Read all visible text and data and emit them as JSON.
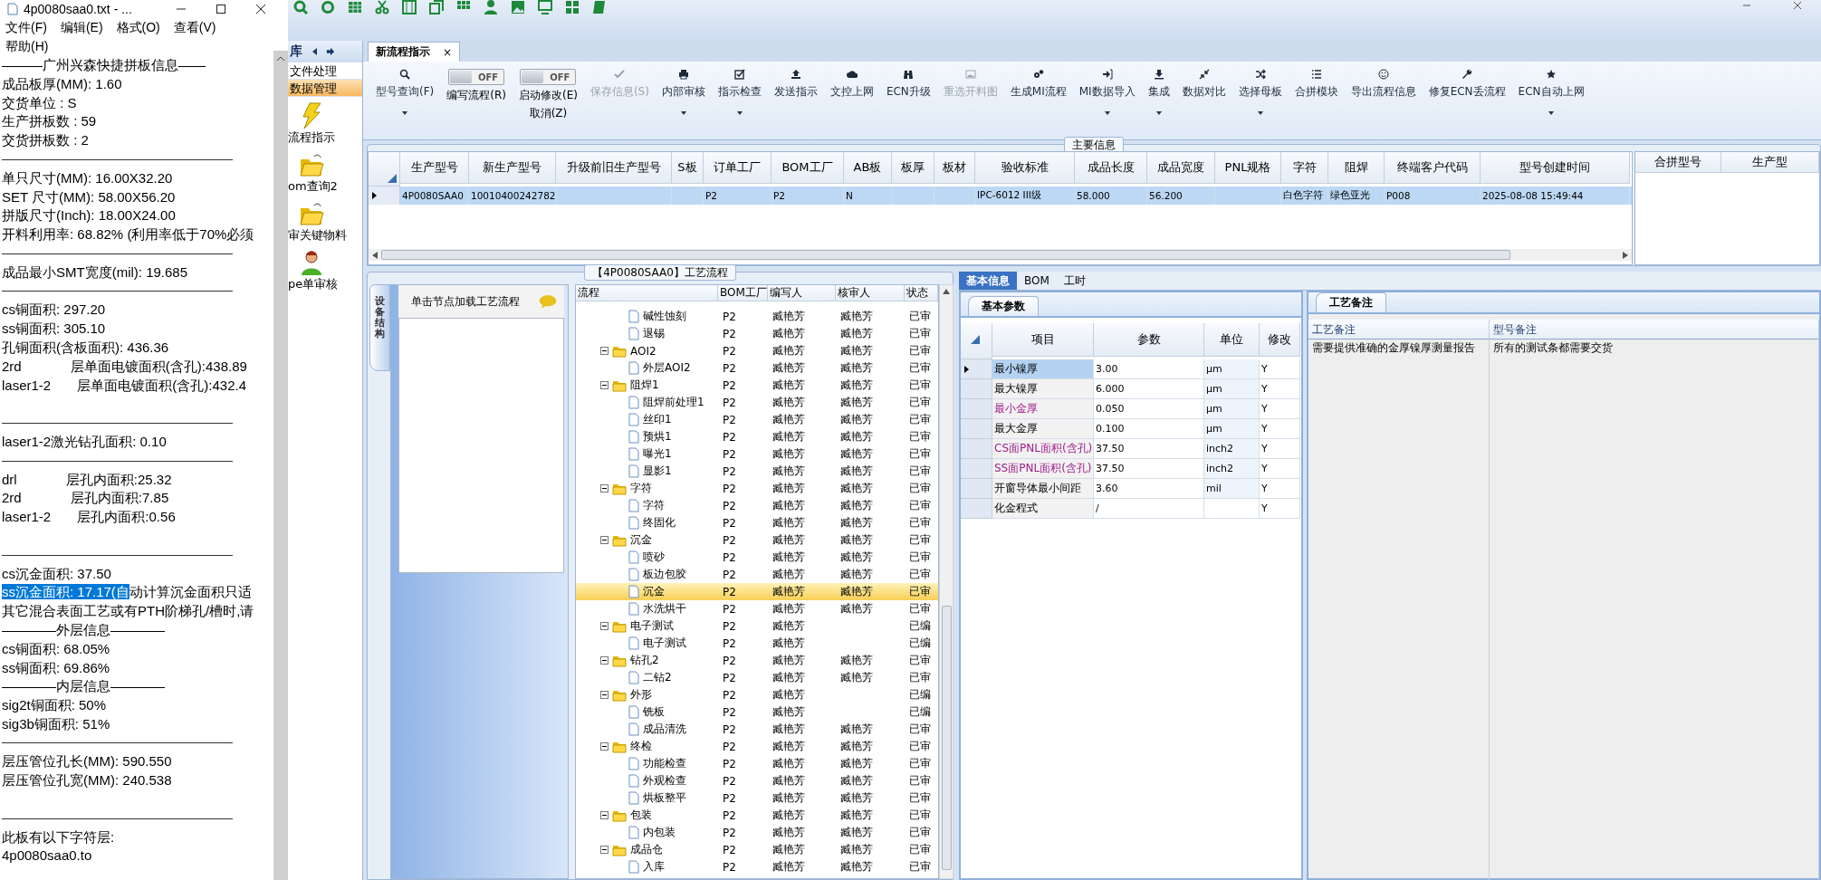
{
  "notepad": {
    "title": "4p0080saa0.txt - ...",
    "menu": [
      "文件(F)",
      "编辑(E)",
      "格式(O)",
      "查看(V)",
      "帮助(H)"
    ],
    "lines": [
      {
        "kind": "text",
        "text": "———广州兴森快捷拼板信息——"
      },
      {
        "kind": "text",
        "text": "成品板厚(MM): 1.60"
      },
      {
        "kind": "text",
        "text": "交货单位 : S"
      },
      {
        "kind": "text",
        "text": "生产拼板数 : 59"
      },
      {
        "kind": "text",
        "text": "交货拼板数 : 2"
      },
      {
        "kind": "rule"
      },
      {
        "kind": "text",
        "text": "单只尺寸(MM): 16.00X32.20"
      },
      {
        "kind": "text",
        "text": "SET 尺寸(MM): 58.00X56.20"
      },
      {
        "kind": "text",
        "text": "拼版尺寸(Inch): 18.00X24.00"
      },
      {
        "kind": "text",
        "text": "开料利用率: 68.82% (利用率低于70%必须"
      },
      {
        "kind": "rule"
      },
      {
        "kind": "text",
        "text": "成品最小SMT宽度(mil): 19.685"
      },
      {
        "kind": "rule"
      },
      {
        "kind": "text",
        "text": "cs铜面积: 297.20"
      },
      {
        "kind": "text",
        "text": "ss铜面积: 305.10"
      },
      {
        "kind": "text",
        "text": "孔铜面积(含板面积): 436.36"
      },
      {
        "kind": "text",
        "text": "2rd             层单面电镀面积(含孔):438.89"
      },
      {
        "kind": "text",
        "text": "laser1-2       层单面电镀面积(含孔):432.4"
      },
      {
        "kind": "blank"
      },
      {
        "kind": "rule"
      },
      {
        "kind": "text",
        "text": "laser1-2激光钻孔面积: 0.10"
      },
      {
        "kind": "rule"
      },
      {
        "kind": "text",
        "text": "drl             层孔内面积:25.32"
      },
      {
        "kind": "text",
        "text": "2rd             层孔内面积:7.85"
      },
      {
        "kind": "text",
        "text": "laser1-2       层孔内面积:0.56"
      },
      {
        "kind": "blank"
      },
      {
        "kind": "rule"
      },
      {
        "kind": "text",
        "text": "cs沉金面积: 37.50"
      },
      {
        "kind": "text",
        "selected_text": "ss沉金面积: 17.17(自",
        "text": "动计算沉金面积只适"
      },
      {
        "kind": "text",
        "text": "其它混合表面工艺或有PTH阶梯孔/槽时,请"
      },
      {
        "kind": "text",
        "text": "————外层信息————"
      },
      {
        "kind": "text",
        "text": "cs铜面积: 68.05%"
      },
      {
        "kind": "text",
        "text": "ss铜面积: 69.86%"
      },
      {
        "kind": "text",
        "text": "————内层信息————"
      },
      {
        "kind": "text",
        "text": "sig2t铜面积: 50%"
      },
      {
        "kind": "text",
        "text": "sig3b铜面积: 51%"
      },
      {
        "kind": "rule"
      },
      {
        "kind": "text",
        "text": "层压管位孔长(MM): 590.550"
      },
      {
        "kind": "text",
        "text": "层压管位孔宽(MM): 240.538"
      },
      {
        "kind": "blank"
      },
      {
        "kind": "rule"
      },
      {
        "kind": "text",
        "text": "此板有以下字符层:"
      },
      {
        "kind": "text",
        "text": "4p0080saa0.to"
      }
    ]
  },
  "sidebar": {
    "title": "库",
    "items": [
      {
        "label": "文件处理",
        "selected": false
      },
      {
        "label": "数据管理",
        "selected": true
      }
    ],
    "tools": [
      {
        "label": "流程指示"
      },
      {
        "label": "om查询2"
      },
      {
        "label": "审关键物料"
      },
      {
        "label": "pe单审核"
      }
    ]
  },
  "document_tab": {
    "label": "新流程指示",
    "close": "×"
  },
  "ribbon": {
    "buttons": [
      {
        "kind": "button",
        "label": "型号查询(F)",
        "dropdown": true,
        "disabled": false
      },
      {
        "kind": "toggle",
        "switch_text": "OFF",
        "on": false,
        "label": "编写流程(R)"
      },
      {
        "kind": "toggle",
        "switch_text": "OFF",
        "on": false,
        "label": "启动修改(E)",
        "sub_label": "取消(Z)"
      },
      {
        "kind": "button",
        "label": "保存信息(S)",
        "dropdown": false,
        "disabled": true
      },
      {
        "kind": "button",
        "label": "内部审核",
        "dropdown": true,
        "disabled": false
      },
      {
        "kind": "button",
        "label": "指示检查",
        "dropdown": true,
        "disabled": false
      },
      {
        "kind": "button",
        "label": "发送指示",
        "dropdown": false,
        "disabled": false
      },
      {
        "kind": "button",
        "label": "文控上网",
        "dropdown": false,
        "disabled": false
      },
      {
        "kind": "button",
        "label": "ECN升级",
        "dropdown": false,
        "disabled": false
      },
      {
        "kind": "button",
        "label": "重选开料图",
        "dropdown": false,
        "disabled": true
      },
      {
        "kind": "button",
        "label": "生成MI流程",
        "dropdown": false,
        "disabled": false
      },
      {
        "kind": "button",
        "label": "MI数据导入",
        "dropdown": true,
        "disabled": false
      },
      {
        "kind": "button",
        "label": "集成",
        "dropdown": true,
        "disabled": false
      },
      {
        "kind": "button",
        "label": "数据对比",
        "dropdown": false,
        "disabled": false
      },
      {
        "kind": "button",
        "label": "选择母板",
        "dropdown": true,
        "disabled": false
      },
      {
        "kind": "button",
        "label": "合拼模块",
        "dropdown": false,
        "disabled": false
      },
      {
        "kind": "button",
        "label": "导出流程信息",
        "dropdown": false,
        "disabled": false
      },
      {
        "kind": "button",
        "label": "修复ECN丢流程",
        "dropdown": false,
        "disabled": false
      },
      {
        "kind": "button",
        "label": "ECN自动上网",
        "dropdown": true,
        "disabled": false
      }
    ]
  },
  "main_info": {
    "title": "主要信息",
    "columns": [
      "生产型号",
      "新生产型号",
      "升级前旧生产型号",
      "S板",
      "订单工厂",
      "BOM工厂",
      "AB板",
      "板厚",
      "板材",
      "验收标准",
      "成品长度",
      "成品宽度",
      "PNL规格",
      "字符",
      "阻焊",
      "终端客户代码",
      "型号创建时间"
    ],
    "rows": [
      {
        "selected": true,
        "cells": [
          "4P0080SAA0",
          "10010400242782",
          "",
          "",
          "P2",
          "P2",
          "N",
          "",
          "",
          "IPC-6012 III级",
          "58.000",
          "56.200",
          "",
          "白色字符",
          "绿色亚光",
          "P008",
          "2025-08-08 15:49:44"
        ]
      }
    ],
    "merge_columns": [
      "合拼型号",
      "生产型"
    ]
  },
  "process_flow": {
    "title": "【4P0080SAA0】工艺流程",
    "side_tab": "设备结构",
    "hint": "单击节点加载工艺流程",
    "columns": [
      "流程",
      "BOM工厂",
      "编写人",
      "核审人",
      "状态"
    ],
    "nodes": [
      {
        "kind": "group_scrolled",
        "children": [
          {
            "label": "碱性蚀刻",
            "bom_factory": "P2",
            "author": "臧艳芳",
            "reviewer": "臧艳芳",
            "status": "已审",
            "selected": false
          },
          {
            "label": "退锡",
            "bom_factory": "P2",
            "author": "臧艳芳",
            "reviewer": "臧艳芳",
            "status": "已审",
            "selected": false
          }
        ]
      },
      {
        "kind": "group",
        "label": "AOI2",
        "bom_factory": "P2",
        "author": "臧艳芳",
        "reviewer": "臧艳芳",
        "status": "已审",
        "selected": false,
        "expanded": true,
        "children": [
          {
            "label": "外层AOI2",
            "bom_factory": "P2",
            "author": "臧艳芳",
            "reviewer": "臧艳芳",
            "status": "已审",
            "selected": false
          }
        ]
      },
      {
        "kind": "group",
        "label": "阻焊1",
        "bom_factory": "P2",
        "author": "臧艳芳",
        "reviewer": "臧艳芳",
        "status": "已审",
        "selected": false,
        "expanded": true,
        "children": [
          {
            "label": "阻焊前处理1",
            "bom_factory": "P2",
            "author": "臧艳芳",
            "reviewer": "臧艳芳",
            "status": "已审",
            "selected": false
          },
          {
            "label": "丝印1",
            "bom_factory": "P2",
            "author": "臧艳芳",
            "reviewer": "臧艳芳",
            "status": "已审",
            "selected": false
          },
          {
            "label": "预烘1",
            "bom_factory": "P2",
            "author": "臧艳芳",
            "reviewer": "臧艳芳",
            "status": "已审",
            "selected": false
          },
          {
            "label": "曝光1",
            "bom_factory": "P2",
            "author": "臧艳芳",
            "reviewer": "臧艳芳",
            "status": "已审",
            "selected": false
          },
          {
            "label": "显影1",
            "bom_factory": "P2",
            "author": "臧艳芳",
            "reviewer": "臧艳芳",
            "status": "已审",
            "selected": false
          }
        ]
      },
      {
        "kind": "group",
        "label": "字符",
        "bom_factory": "P2",
        "author": "臧艳芳",
        "reviewer": "臧艳芳",
        "status": "已审",
        "selected": false,
        "expanded": true,
        "children": [
          {
            "label": "字符",
            "bom_factory": "P2",
            "author": "臧艳芳",
            "reviewer": "臧艳芳",
            "status": "已审",
            "selected": false
          },
          {
            "label": "终固化",
            "bom_factory": "P2",
            "author": "臧艳芳",
            "reviewer": "臧艳芳",
            "status": "已审",
            "selected": false
          }
        ]
      },
      {
        "kind": "group",
        "label": "沉金",
        "bom_factory": "P2",
        "author": "臧艳芳",
        "reviewer": "臧艳芳",
        "status": "已审",
        "selected": false,
        "expanded": true,
        "children": [
          {
            "label": "喷砂",
            "bom_factory": "P2",
            "author": "臧艳芳",
            "reviewer": "臧艳芳",
            "status": "已审",
            "selected": false
          },
          {
            "label": "板边包胶",
            "bom_factory": "P2",
            "author": "臧艳芳",
            "reviewer": "臧艳芳",
            "status": "已审",
            "selected": false
          },
          {
            "label": "沉金",
            "bom_factory": "P2",
            "author": "臧艳芳",
            "reviewer": "臧艳芳",
            "status": "已审",
            "selected": true
          },
          {
            "label": "水洗烘干",
            "bom_factory": "P2",
            "author": "臧艳芳",
            "reviewer": "臧艳芳",
            "status": "已审",
            "selected": false
          }
        ]
      },
      {
        "kind": "group",
        "label": "电子测试",
        "bom_factory": "P2",
        "author": "臧艳芳",
        "status": "已编",
        "selected": false,
        "expanded": true,
        "children": [
          {
            "label": "电子测试",
            "bom_factory": "P2",
            "author": "臧艳芳",
            "status": "已编",
            "selected": false
          }
        ]
      },
      {
        "kind": "group",
        "label": "钻孔2",
        "bom_factory": "P2",
        "author": "臧艳芳",
        "reviewer": "臧艳芳",
        "status": "已审",
        "selected": false,
        "expanded": true,
        "children": [
          {
            "label": "二钻2",
            "bom_factory": "P2",
            "author": "臧艳芳",
            "reviewer": "臧艳芳",
            "status": "已审",
            "selected": false
          }
        ]
      },
      {
        "kind": "group",
        "label": "外形",
        "bom_factory": "P2",
        "author": "臧艳芳",
        "status": "已编",
        "selected": false,
        "expanded": true,
        "children": [
          {
            "label": "铣板",
            "bom_factory": "P2",
            "author": "臧艳芳",
            "status": "已编",
            "selected": false
          },
          {
            "label": "成品清洗",
            "bom_factory": "P2",
            "author": "臧艳芳",
            "reviewer": "臧艳芳",
            "status": "已审",
            "selected": false
          }
        ]
      },
      {
        "kind": "group",
        "label": "终检",
        "bom_factory": "P2",
        "author": "臧艳芳",
        "reviewer": "臧艳芳",
        "status": "已审",
        "selected": false,
        "expanded": true,
        "children": [
          {
            "label": "功能检查",
            "bom_factory": "P2",
            "author": "臧艳芳",
            "reviewer": "臧艳芳",
            "status": "已审",
            "selected": false
          },
          {
            "label": "外观检查",
            "bom_factory": "P2",
            "author": "臧艳芳",
            "reviewer": "臧艳芳",
            "status": "已审",
            "selected": false
          },
          {
            "label": "烘板整平",
            "bom_factory": "P2",
            "author": "臧艳芳",
            "reviewer": "臧艳芳",
            "status": "已审",
            "selected": false
          }
        ]
      },
      {
        "kind": "group",
        "label": "包装",
        "bom_factory": "P2",
        "author": "臧艳芳",
        "reviewer": "臧艳芳",
        "status": "已审",
        "selected": false,
        "expanded": true,
        "children": [
          {
            "label": "内包装",
            "bom_factory": "P2",
            "author": "臧艳芳",
            "reviewer": "臧艳芳",
            "status": "已审",
            "selected": false
          }
        ]
      },
      {
        "kind": "group",
        "label": "成品仓",
        "bom_factory": "P2",
        "author": "臧艳芳",
        "reviewer": "臧艳芳",
        "status": "已审",
        "selected": false,
        "expanded": true,
        "children": [
          {
            "label": "入库",
            "bom_factory": "P2",
            "author": "臧艳芳",
            "reviewer": "臧艳芳",
            "status": "已审",
            "selected": false
          }
        ]
      }
    ]
  },
  "detail_tabs": [
    {
      "label": "基本信息",
      "selected": true
    },
    {
      "label": "BOM",
      "selected": false
    },
    {
      "label": "工时",
      "selected": false
    }
  ],
  "parameters": {
    "tab": "基本参数",
    "columns": [
      "项目",
      "参数",
      "单位",
      "修改"
    ],
    "rows": [
      {
        "item": "最小镍厚",
        "value": "3.00",
        "unit": "μm",
        "modified": "Y",
        "emphasized": false,
        "selected": true
      },
      {
        "item": "最大镍厚",
        "value": "6.000",
        "unit": "μm",
        "modified": "Y",
        "emphasized": false,
        "selected": false
      },
      {
        "item": "最小金厚",
        "value": "0.050",
        "unit": "μm",
        "modified": "Y",
        "emphasized": true,
        "selected": false
      },
      {
        "item": "最大金厚",
        "value": "0.100",
        "unit": "μm",
        "modified": "Y",
        "emphasized": false,
        "selected": false
      },
      {
        "item": "CS面PNL面积(含孔)",
        "value": "37.50",
        "unit": "inch2",
        "modified": "Y",
        "emphasized": true,
        "selected": false
      },
      {
        "item": "SS面PNL面积(含孔)",
        "value": "37.50",
        "unit": "inch2",
        "modified": "Y",
        "emphasized": true,
        "selected": false
      },
      {
        "item": "开窗导体最小间距",
        "value": "3.60",
        "unit": "mil",
        "modified": "Y",
        "emphasized": false,
        "selected": false
      },
      {
        "item": "化金程式",
        "value": "/",
        "modified": "Y",
        "emphasized": false,
        "selected": false
      }
    ]
  },
  "notes": {
    "tab": "工艺备注",
    "columns": [
      "工艺备注",
      "型号备注"
    ],
    "process_note": "需要提供准确的金厚镍厚测量报告",
    "model_note": "所有的测试条都需要交货"
  }
}
